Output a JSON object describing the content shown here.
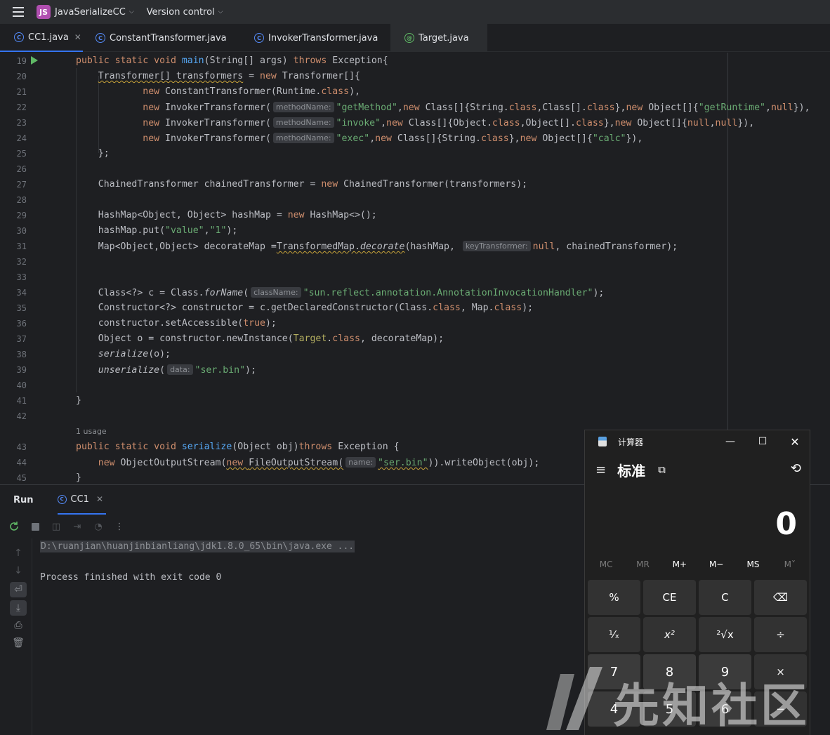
{
  "titlebar": {
    "project_badge": "JS",
    "project_name": "JavaSerializeCC",
    "vcs_label": "Version control"
  },
  "tabs": [
    {
      "label": "CC1.java",
      "icon": "C",
      "active": true,
      "closable": true
    },
    {
      "label": "ConstantTransformer.java",
      "icon": "C"
    },
    {
      "label": "InvokerTransformer.java",
      "icon": "C"
    },
    {
      "label": "Target.java",
      "icon": "@"
    }
  ],
  "editor": {
    "line_numbers": [
      "19",
      "20",
      "21",
      "22",
      "23",
      "24",
      "25",
      "26",
      "27",
      "28",
      "29",
      "30",
      "31",
      "32",
      "33",
      "34",
      "35",
      "36",
      "37",
      "38",
      "39",
      "40",
      "41",
      "42",
      "43",
      "44",
      "45"
    ],
    "usage_hint": "1 usage",
    "hints": {
      "methodName": "methodName:",
      "keyTransformer": "keyTransformer:",
      "className": "className:",
      "data": "data:",
      "name": "name:"
    }
  },
  "run": {
    "title": "Run",
    "tab_label": "CC1",
    "tab_icon": "C",
    "console": {
      "command": "D:\\ruanjian\\huanjinbianliang\\jdk1.8.0_65\\bin\\java.exe ...",
      "result": "Process finished with exit code 0"
    }
  },
  "calculator": {
    "app_title": "计算器",
    "mode": "标准",
    "display": "0",
    "memory": [
      "MC",
      "MR",
      "M+",
      "M−",
      "MS",
      "M˅"
    ],
    "keys": {
      "row1": [
        "%",
        "CE",
        "C",
        "⌫"
      ],
      "row2": [
        "¹⁄ₓ",
        "x²",
        "²√x",
        "÷"
      ],
      "row3": [
        "7",
        "8",
        "9",
        "×"
      ],
      "row4": [
        "4",
        "5",
        "6",
        "−"
      ]
    }
  },
  "watermark": {
    "text": "先知社区"
  }
}
